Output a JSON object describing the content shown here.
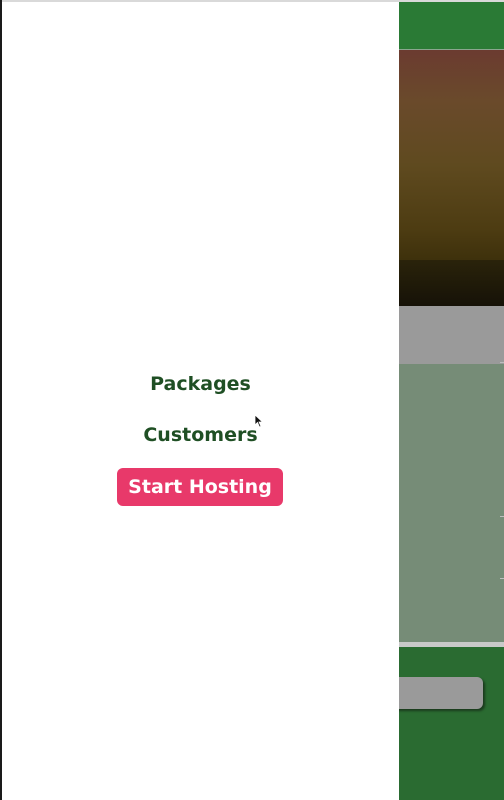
{
  "drawer": {
    "nav": {
      "packages_label": "Packages",
      "customers_label": "Customers",
      "cta_label": "Start Hosting"
    }
  },
  "colors": {
    "nav_text": "#1f4f24",
    "cta_background": "#e8396a",
    "cta_text": "#ffffff",
    "background_header": "#2a7a35",
    "background_footer": "#2a6b31",
    "background_section": "#768c77"
  },
  "icons": {
    "pointer": "mouse-pointer-icon"
  }
}
